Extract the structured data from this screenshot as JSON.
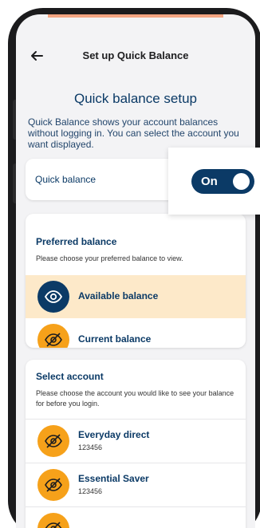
{
  "header": {
    "title": "Set up Quick Balance"
  },
  "setup": {
    "title": "Quick balance setup",
    "description": "Quick Balance shows your account balances without logging in. You can select the account you want displayed."
  },
  "quick_balance": {
    "label": "Quick balance",
    "toggle_state": "On"
  },
  "preferred_balance": {
    "title": "Preferred balance",
    "subtitle": "Please choose your preferred balance to view.",
    "options": [
      {
        "label": "Available balance",
        "selected": true,
        "icon": "eye-icon"
      },
      {
        "label": "Current balance",
        "selected": false,
        "icon": "eye-off-icon"
      }
    ]
  },
  "select_account": {
    "title": "Select account",
    "subtitle": "Please choose the account you would like to see your balance for before you login.",
    "accounts": [
      {
        "name": "Everyday direct",
        "number": "123456",
        "icon": "eye-off-icon"
      },
      {
        "name": "Essential Saver",
        "number": "123456",
        "icon": "eye-off-icon"
      },
      {
        "name": "",
        "number": "",
        "icon": "eye-off-icon"
      }
    ]
  },
  "colors": {
    "brand_navy": "#0b3a66",
    "accent_orange": "#f6a11a",
    "selected_bg": "#fde9c9"
  }
}
